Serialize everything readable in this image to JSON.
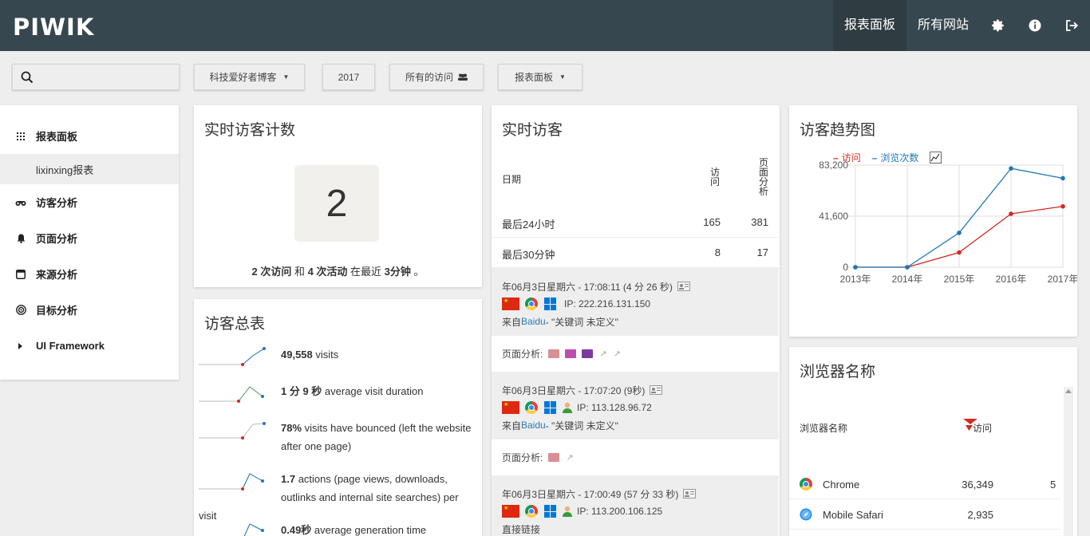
{
  "app": {
    "logo": "PIWIK",
    "nav": {
      "dashboard": "报表面板",
      "all_sites": "所有网站"
    }
  },
  "filters": {
    "site": "科技爱好者博客",
    "period": "2017",
    "segment": "所有的访问",
    "dashboard": "报表面板"
  },
  "sidebar": {
    "items": [
      {
        "label": "报表面板",
        "icon": "grid-icon"
      },
      {
        "label": "lixinxing报表"
      },
      {
        "label": "访客分析",
        "icon": "binoculars-icon"
      },
      {
        "label": "页面分析",
        "icon": "bell-icon"
      },
      {
        "label": "来源分析",
        "icon": "window-icon"
      },
      {
        "label": "目标分析",
        "icon": "target-icon"
      },
      {
        "label": "UI Framework",
        "icon": "caret-right-icon"
      }
    ]
  },
  "realtime_counter": {
    "title": "实时访客计数",
    "count": "2",
    "visits_num": "2 次访问",
    "and": " 和 ",
    "actions_num": "4 次活动",
    "in_last": " 在最近 ",
    "minutes": "3分钟",
    "dot": " 。"
  },
  "visits_overview": {
    "title": "访客总表",
    "rows": [
      {
        "value": "49,558",
        "text": " visits"
      },
      {
        "value": "1 分 9 秒",
        "text": " average visit duration"
      },
      {
        "value": "78%",
        "text": " visits have bounced (left the website after one page)"
      },
      {
        "value": "1.7",
        "text": " actions (page views, downloads, outlinks and internal site searches) per visit"
      },
      {
        "value": "0.49秒",
        "text": " average generation time"
      }
    ]
  },
  "realtime_visitors": {
    "title": "实时访客",
    "col_date": "日期",
    "col_visits": "访问",
    "col_pages": "页面分析",
    "rows": [
      {
        "label": "最后24小时",
        "visits": "165",
        "pages": "381"
      },
      {
        "label": "最后30分钟",
        "visits": "8",
        "pages": "17"
      }
    ],
    "visits": [
      {
        "time": "年06月3日星期六 - 17:08:11 (4 分 26 秒)",
        "ip": "IP: 222.216.131.150",
        "from": "来自 ",
        "source": "Baidu",
        "keyword": " - \"关键词 未定义\"",
        "pages_label": "页面分析:"
      },
      {
        "time": "年06月3日星期六 - 17:07:20 (9秒)",
        "ip": "IP: 113.128.96.72",
        "from": "来自 ",
        "source": "Baidu",
        "keyword": " - \"关键词 未定义\"",
        "pages_label": "页面分析:"
      },
      {
        "time": "年06月3日星期六 - 17:00:49 (57 分 33 秒)",
        "ip": "IP: 113.200.106.125",
        "direct": "直接链接"
      }
    ]
  },
  "visitor_trend": {
    "title": "访客趋势图",
    "legend_visits": "访问",
    "legend_views": "浏览次数"
  },
  "chart_data": {
    "type": "line",
    "categories": [
      "2013年",
      "2014年",
      "2015年",
      "2016年",
      "2017年"
    ],
    "yticks": [
      "83,200",
      "41,600",
      "0"
    ],
    "ylim": [
      0,
      83200
    ],
    "series": [
      {
        "name": "访问",
        "color": "#d4291f",
        "values": [
          0,
          0,
          12000,
          43500,
          49558
        ]
      },
      {
        "name": "浏览次数",
        "color": "#1f78b4",
        "values": [
          0,
          0,
          28000,
          80500,
          72500
        ]
      }
    ]
  },
  "browsers": {
    "title": "浏览器名称",
    "col_name": "浏览器名称",
    "col_visits": "访问",
    "rows": [
      {
        "name": "Chrome",
        "visits": "36,349",
        "extra": "5"
      },
      {
        "name": "Mobile Safari",
        "visits": "2,935",
        "extra": ""
      }
    ]
  },
  "colors": {
    "topbar": "#37474f",
    "link": "#2c7bb6",
    "visits_series": "#d4291f",
    "views_series": "#1f78b4"
  }
}
